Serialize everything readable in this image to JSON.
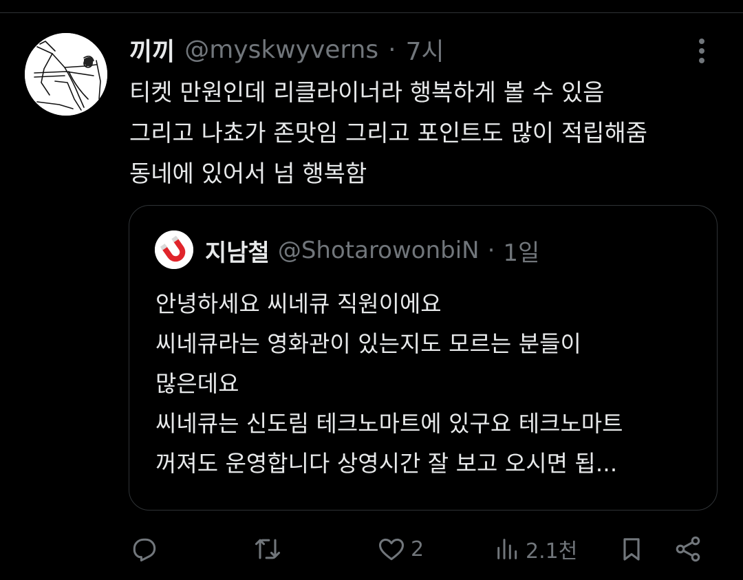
{
  "tweet": {
    "display_name": "끼끼",
    "handle": "@myskwyverns",
    "dot": "·",
    "time": "7시",
    "body_lines": [
      "티켓 만원인데 리클라이너라 행복하게 볼 수 있음",
      "그리고 나쵸가 존맛임 그리고 포인트도 많이 적립해줌",
      "동네에 있어서 넘 행복함"
    ]
  },
  "quote": {
    "display_name": "지남철",
    "handle": "@ShotarowonbiN",
    "dot": "·",
    "time": "1일",
    "body_lines": [
      "안녕하세요 씨네큐 직원이에요",
      "씨네큐라는 영화관이 있는지도 모르는 분들이",
      "많은데요",
      "씨네큐는 신도림 테크노마트에 있구요 테크노마트",
      "꺼져도 운영합니다 상영시간 잘 보고 오시면 됩..."
    ]
  },
  "actions": {
    "reply_icon": "reply-icon",
    "retweet_icon": "retweet-icon",
    "like_icon": "heart-icon",
    "like_count": "2",
    "views_icon": "views-icon",
    "views_count": "2.1천",
    "bookmark_icon": "bookmark-icon",
    "share_icon": "share-icon"
  },
  "colors": {
    "background": "#000000",
    "text_primary": "#e7e9ea",
    "text_secondary": "#71767b",
    "border": "#2f3336",
    "magnet_red": "#e0242b"
  }
}
